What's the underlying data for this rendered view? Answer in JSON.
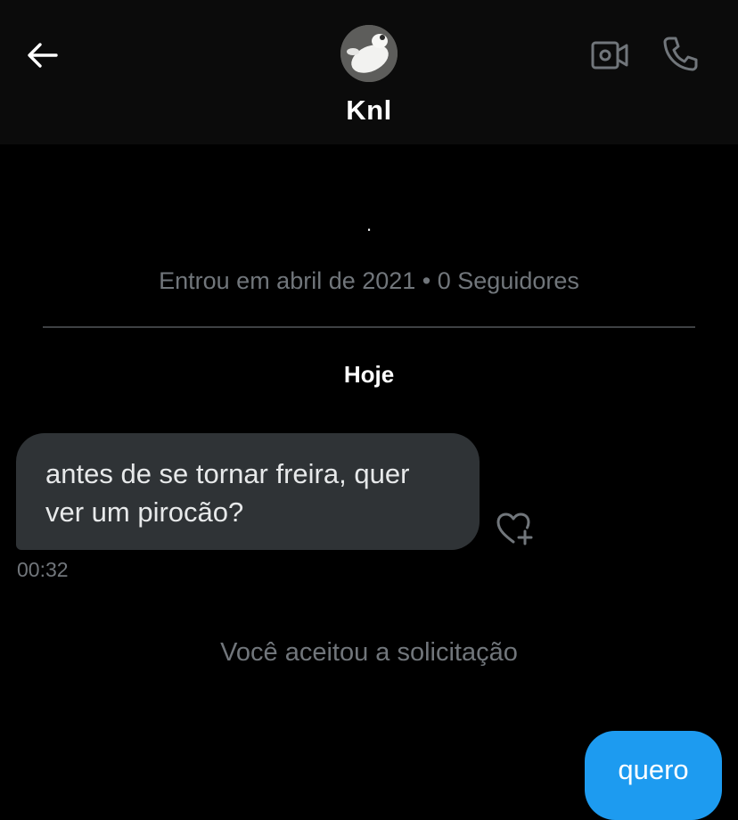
{
  "header": {
    "contact_name": "Knl",
    "icons": {
      "back": "arrow-left-icon",
      "video": "video-camera-icon",
      "call": "phone-icon"
    }
  },
  "profile": {
    "bio": "·",
    "meta": "Entrou em abril de 2021 • 0 Seguidores"
  },
  "conversation": {
    "date_label": "Hoje",
    "messages": [
      {
        "direction": "incoming",
        "text": "antes de se tornar freira, quer ver um pirocão?",
        "time": "00:32"
      },
      {
        "direction": "outgoing",
        "text": "quero"
      }
    ],
    "system_notice": "Você aceitou a solicitação"
  },
  "colors": {
    "background": "#000000",
    "header": "#0b0b0b",
    "incoming_bubble": "#2f3336",
    "outgoing_bubble": "#1d9bf0",
    "muted_text": "#71767b"
  }
}
